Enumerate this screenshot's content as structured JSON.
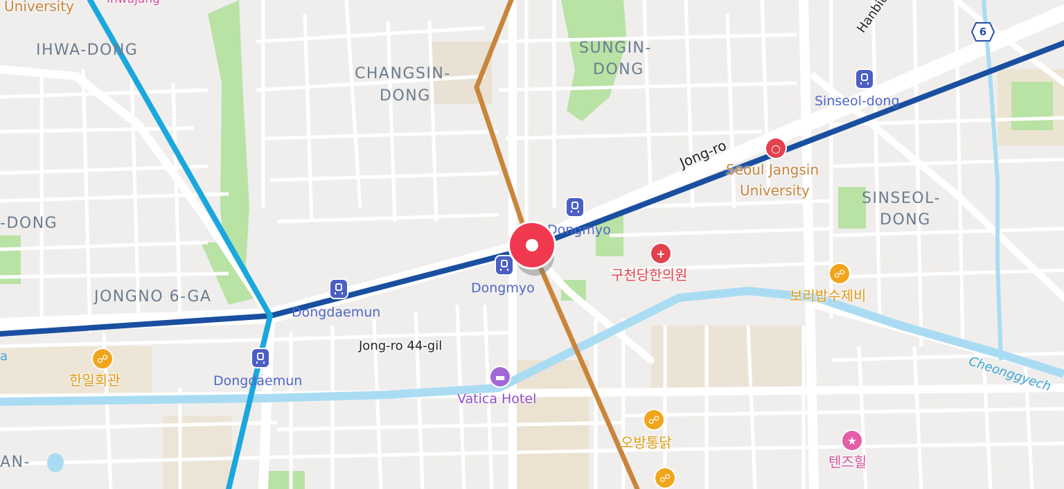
{
  "map": {
    "districts": {
      "ihwa": "IHWA-DONG",
      "changsin_1": "CHANGSIN-",
      "changsin_2": "DONG",
      "sungin_1": "SUNGIN-",
      "sungin_2": "DONG",
      "sinseol_1": "SINSEOL-",
      "sinseol_2": "DONG",
      "jongno6ga": "JONGNO 6-GA",
      "left_dong": "-DONG",
      "left_an": "AN-"
    },
    "top_labels": {
      "university_cut": "University",
      "ihwajang_cut": "Ihwajang",
      "hanbit": "Hanbit-"
    },
    "streets": {
      "jong_ro": "Jong-ro",
      "jong_ro_44gil": "Jong-ro 44-gil"
    },
    "stations": {
      "sinseol_dong": "Sinseol-dong",
      "dongmyo_north": "Dongmyo",
      "dongmyo_south": "Dongmyo",
      "dongdaemun_north": "Dongdaemun",
      "dongdaemun_south": "Dongdaemun"
    },
    "pois": {
      "seoul_jangsin_1": "Seoul Jangsin",
      "seoul_jangsin_2": "University",
      "clinic": "구천당한의원",
      "food_boribap": "보리밥수제비",
      "food_hanil": "한일회관",
      "food_obang": "오방통닭",
      "hotel": "Vatica Hotel",
      "entertainment": "텐즈힐"
    },
    "river": "Cheonggyech",
    "route_shield": "6",
    "left_cut_a": "a",
    "colors": {
      "line1_blue": "#1a4fa0",
      "line4_skyblue": "#1aa7dd",
      "line6_brown": "#c9853c",
      "pin_red": "#f0384e",
      "water": "#a9dcf3",
      "park": "#b9e2a5"
    }
  }
}
